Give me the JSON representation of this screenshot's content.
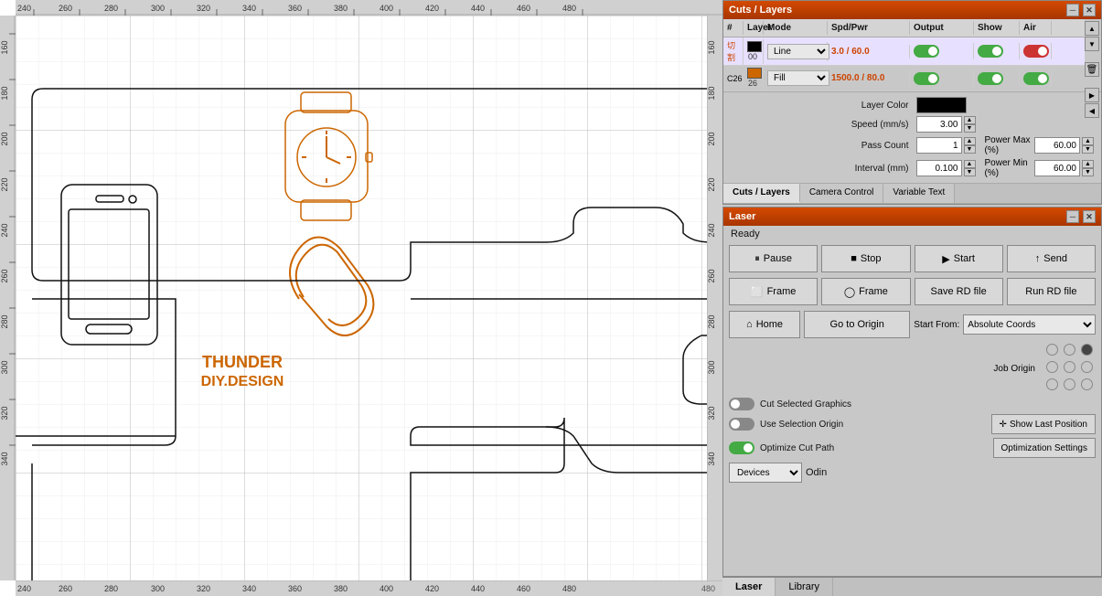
{
  "canvas": {
    "ruler_marks_top": [
      "240",
      "260",
      "280",
      "300",
      "320",
      "340",
      "360",
      "380",
      "400",
      "420",
      "440",
      "460",
      "480"
    ],
    "ruler_marks_left": [
      "160",
      "180",
      "200",
      "220",
      "240",
      "260",
      "280",
      "300",
      "320",
      "340"
    ],
    "ruler_marks_bottom": [
      "240",
      "260",
      "280",
      "300",
      "320",
      "340",
      "360",
      "380",
      "400",
      "420",
      "440",
      "460",
      "480"
    ]
  },
  "cuts_layers": {
    "title": "Cuts / Layers",
    "columns": {
      "num": "#",
      "layer": "Layer",
      "mode": "Mode",
      "spd_pwr": "Spd/Pwr",
      "output": "Output",
      "show": "Show",
      "air": "Air"
    },
    "rows": [
      {
        "num": "切割",
        "layer_num": "00",
        "layer_color": "#000000",
        "mode": "Line",
        "spd_pwr": "3.0 / 60.0",
        "output_on": true,
        "show_on": true,
        "air_on": false,
        "selected": true
      },
      {
        "num": "C26",
        "layer_num": "26",
        "layer_color": "#cc6600",
        "mode": "Fill",
        "spd_pwr": "1500.0 / 80.0",
        "output_on": true,
        "show_on": true,
        "air_on": true,
        "selected": false
      }
    ],
    "settings": {
      "layer_color_label": "Layer Color",
      "layer_color_value": "#000000",
      "speed_label": "Speed (mm/s)",
      "speed_value": "3.00",
      "pass_count_label": "Pass Count",
      "pass_count_value": "1",
      "power_max_label": "Power Max (%)",
      "power_max_value": "60.00",
      "interval_label": "Interval (mm)",
      "interval_value": "0.100",
      "power_min_label": "Power Min (%)",
      "power_min_value": "60.00"
    }
  },
  "tabs": {
    "cuts_layers": "Cuts / Layers",
    "camera_control": "Camera Control",
    "variable_text": "Variable Text"
  },
  "laser": {
    "title": "Laser",
    "status": "Ready",
    "buttons": {
      "pause": "Pause",
      "stop": "Stop",
      "start": "Start",
      "send": "Send",
      "frame1": "Frame",
      "frame2": "Frame",
      "save_rd": "Save RD file",
      "run_rd": "Run RD file",
      "home": "Home",
      "go_to_origin": "Go to Origin",
      "start_from_label": "Start From:",
      "start_from_value": "Absolute Coords",
      "job_origin_label": "Job Origin",
      "show_last_position": "Show Last Position",
      "cut_selected_label": "Cut Selected Graphics",
      "use_selection_label": "Use Selection Origin",
      "optimize_cut_label": "Optimize Cut Path",
      "optimization_settings": "Optimization Settings",
      "devices_label": "Devices",
      "device_name": "Odin"
    }
  },
  "bottom_tabs": {
    "laser": "Laser",
    "library": "Library"
  },
  "icons": {
    "pause": "⏸",
    "stop": "■",
    "start": "▶",
    "send": "↑",
    "frame_square": "⬜",
    "frame_circle": "◯",
    "home": "⌂",
    "crosshair": "✛",
    "up_arrow": "▲",
    "down_arrow": "▼",
    "left_arrow": "◀",
    "right_arrow": "▶",
    "delete": "🗑",
    "minimize": "─",
    "close": "✕",
    "chevron_right": "▶",
    "chevron_left": "◀"
  }
}
